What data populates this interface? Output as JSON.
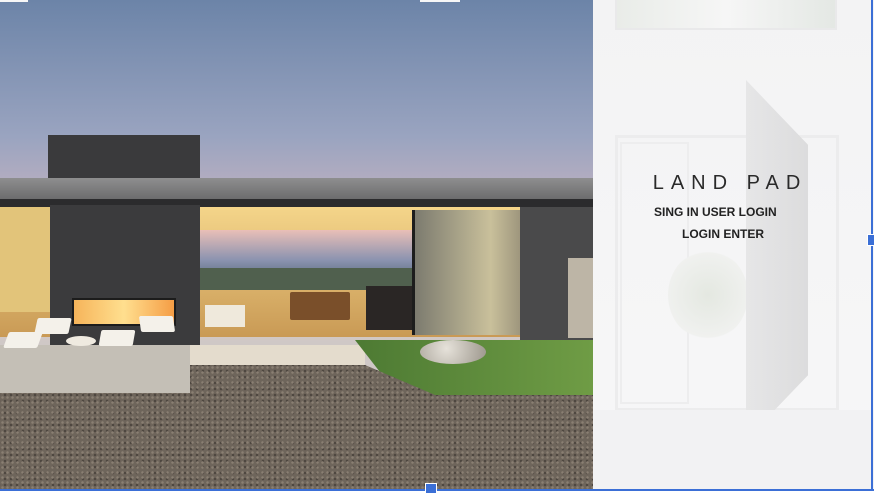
{
  "hero": {
    "description_icon": "house-photo-icon"
  },
  "panel": {
    "brand": "LAND PAD",
    "signin_link": "SING IN USER LOGIN",
    "enter_link": "LOGIN ENTER"
  },
  "colors": {
    "selection_accent": "#3b6fd6",
    "text_dark": "#222222",
    "panel_bg": "#f3f3f4"
  }
}
